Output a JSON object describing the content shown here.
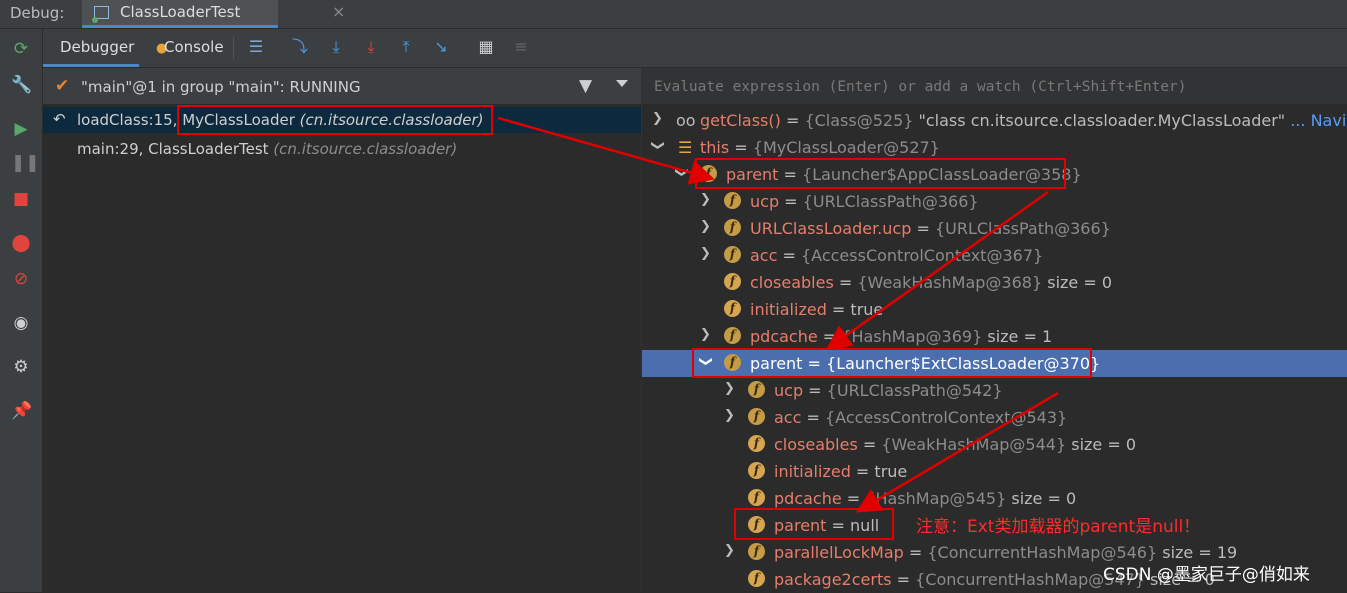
{
  "window": {
    "label": "Debug:",
    "tab": "ClassLoaderTest"
  },
  "toolbar": {
    "debugger_tab": "Debugger",
    "console_tab": "Console"
  },
  "thread": {
    "text": "\"main\"@1 in group \"main\": RUNNING"
  },
  "frames": [
    {
      "method": "loadClass:15, MyClassLoader",
      "pkg": "(cn.itsource.classloader)"
    },
    {
      "method": "main:29, ClassLoaderTest",
      "pkg": "(cn.itsource.classloader)"
    }
  ],
  "evaluate": {
    "placeholder": "Evaluate expression (Enter) or add a watch (Ctrl+Shift+Enter)"
  },
  "variables": [
    {
      "name": "getClass()",
      "eq": " = ",
      "val": "{Class@525}",
      "extra": " \"class cn.itsource.classloader.MyClassLoader\"",
      "nav": " ... Navigate"
    },
    {
      "name": "this",
      "eq": " = ",
      "val": "{MyClassLoader@527}",
      "extra": ""
    },
    {
      "name": "parent",
      "eq": " = ",
      "val": "{Launcher$AppClassLoader@358}",
      "extra": ""
    },
    {
      "name": "ucp",
      "eq": " = ",
      "val": "{URLClassPath@366}",
      "extra": ""
    },
    {
      "name": "URLClassLoader.ucp",
      "eq": " = ",
      "val": "{URLClassPath@366}",
      "extra": ""
    },
    {
      "name": "acc",
      "eq": " = ",
      "val": "{AccessControlContext@367}",
      "extra": ""
    },
    {
      "name": "closeables",
      "eq": " = ",
      "val": "{WeakHashMap@368}",
      "extra": "  size = 0"
    },
    {
      "name": "initialized",
      "eq": " = ",
      "val": "",
      "extra": "true"
    },
    {
      "name": "pdcache",
      "eq": " = ",
      "val": "{HashMap@369}",
      "extra": "  size = 1"
    },
    {
      "name": "parent",
      "eq": " = ",
      "val": "{Launcher$ExtClassLoader@370}",
      "extra": ""
    },
    {
      "name": "ucp",
      "eq": " = ",
      "val": "{URLClassPath@542}",
      "extra": ""
    },
    {
      "name": "acc",
      "eq": " = ",
      "val": "{AccessControlContext@543}",
      "extra": ""
    },
    {
      "name": "closeables",
      "eq": " = ",
      "val": "{WeakHashMap@544}",
      "extra": "  size = 0"
    },
    {
      "name": "initialized",
      "eq": " = ",
      "val": "",
      "extra": "true"
    },
    {
      "name": "pdcache",
      "eq": " = ",
      "val": "{HashMap@545}",
      "extra": "  size = 0"
    },
    {
      "name": "parent",
      "eq": " = ",
      "val": "",
      "extra": "null"
    },
    {
      "name": "parallelLockMap",
      "eq": " = ",
      "val": "{ConcurrentHashMap@546}",
      "extra": "  size = 19"
    },
    {
      "name": "package2certs",
      "eq": " = ",
      "val": "{ConcurrentHashMap@547}",
      "extra": "  size = 0"
    }
  ],
  "annotation": {
    "note": "注意：Ext类加载器的parent是null！",
    "watermark": "CSDN @墨家巨子@俏如来"
  },
  "colors": {
    "field_name": "#e67e6b",
    "selection": "#4b6eaf",
    "annotation_red": "#e00000"
  }
}
